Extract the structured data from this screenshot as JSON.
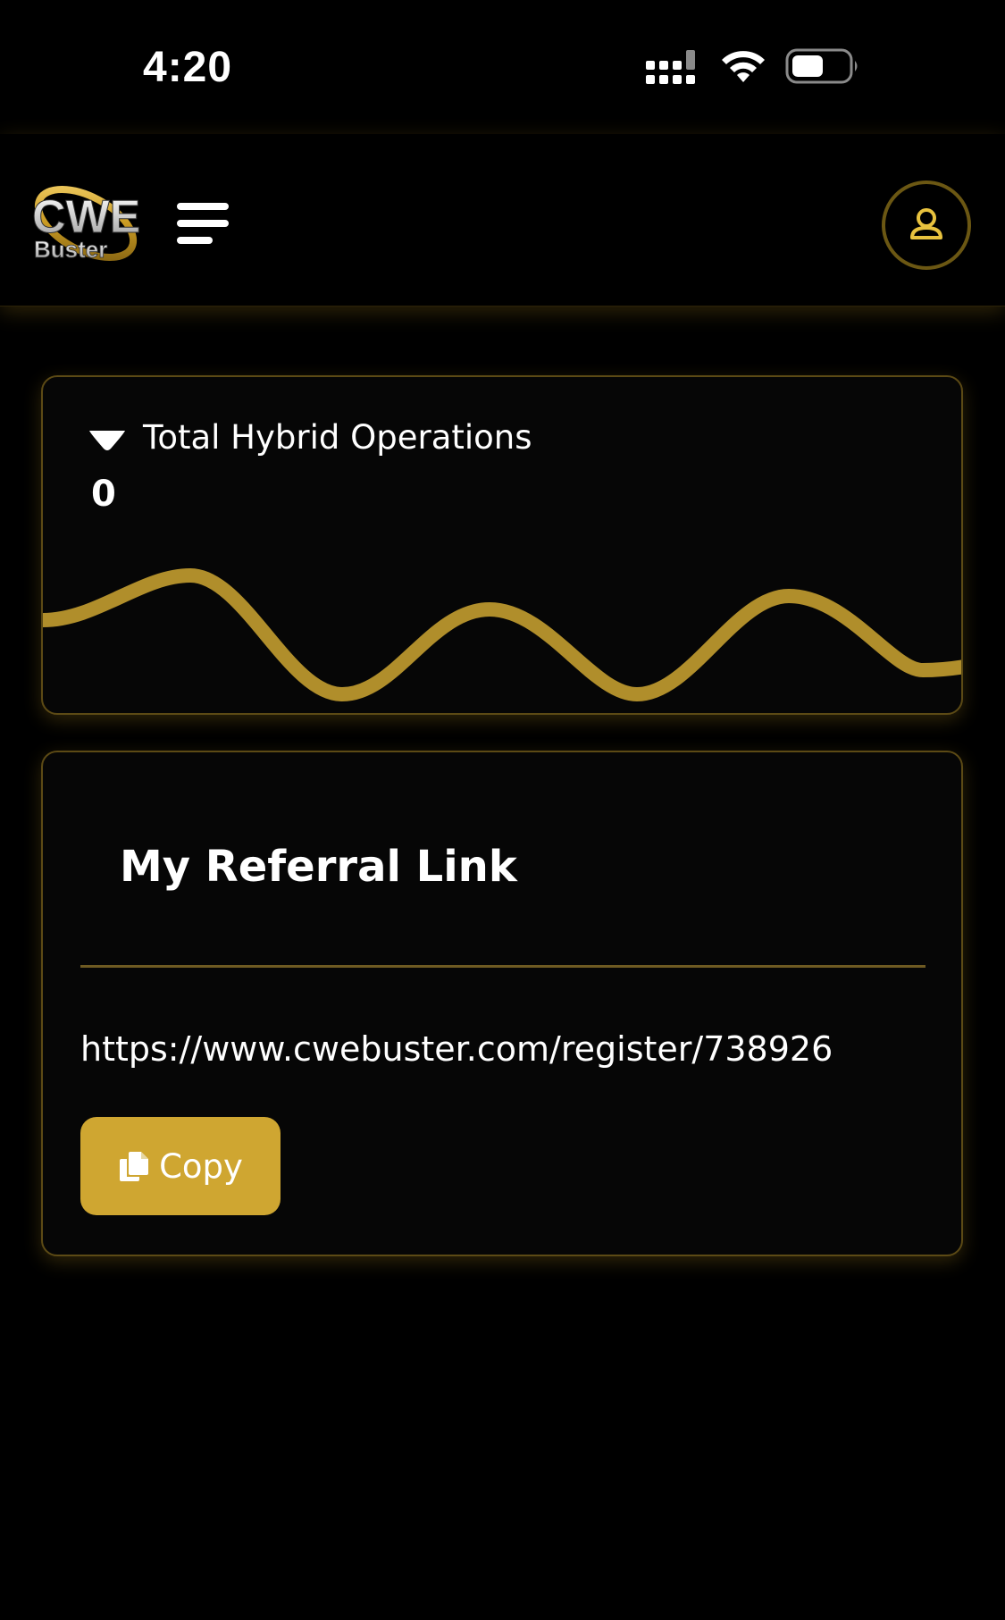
{
  "status_bar": {
    "time": "4:20",
    "icons": [
      "signal-icon",
      "wifi-icon",
      "battery-icon"
    ]
  },
  "header": {
    "logo_alt": "CWE Buster",
    "logo_line1": "CWE",
    "logo_line2": "Buster",
    "menu_icon": "hamburger-menu-icon",
    "profile_icon": "user-icon"
  },
  "ops_card": {
    "title": "Total Hybrid Operations",
    "value": "0",
    "caret_icon": "caret-down-icon"
  },
  "referral_card": {
    "title": "My Referral Link",
    "link": "https://www.cwebuster.com/register/738926",
    "copy_label": "Copy",
    "copy_icon": "copy-icon"
  },
  "colors": {
    "background": "#000000",
    "card": "#060606",
    "accent": "#cfa631",
    "wave": "#b08e2b",
    "border": "#5c4a15"
  }
}
